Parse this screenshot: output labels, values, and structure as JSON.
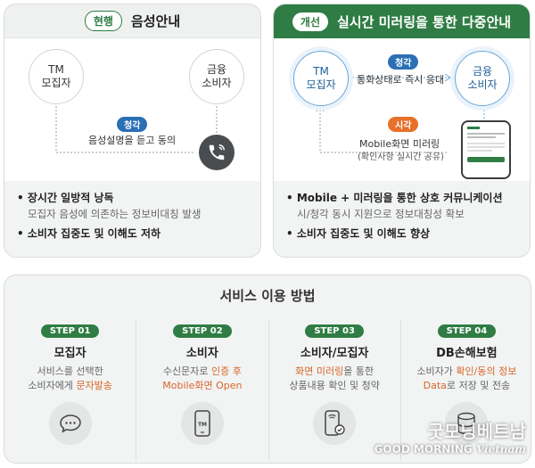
{
  "current": {
    "badge": "현행",
    "title": "음성안내",
    "node_tm": "TM\n모집자",
    "node_consumer": "금융\n소비자",
    "tag": "청각",
    "flow_text": "음성설명을 듣고 동의",
    "bullets": [
      {
        "main": "장시간 일방적 낭독",
        "sub": "모집자 음성에 의존하는 정보비대칭 발생"
      },
      {
        "main": "소비자 집중도 및 이해도 저하",
        "sub": ""
      }
    ]
  },
  "improved": {
    "badge": "개선",
    "title": "실시간 미러링을 통한 다중안내",
    "node_tm": "TM\n모집자",
    "node_consumer": "금융\n소비자",
    "tag_audio": "청각",
    "audio_text": "통화상태로 즉시 응대",
    "tag_visual": "시각",
    "visual_text": "Mobile화면 미러링",
    "visual_sub": "(확인사항 실시간 공유)",
    "bullets": [
      {
        "main": "Mobile + 미러링을 통한 상호 커뮤니케이션",
        "sub": "시/청각 동시 지원으로 정보대칭성 확보"
      },
      {
        "main": "소비자 집중도 및 이해도 향상",
        "sub": ""
      }
    ]
  },
  "service": {
    "title": "서비스 이용 방법",
    "steps": [
      {
        "badge": "STEP 01",
        "title": "모집자",
        "desc1": "서비스를 선택한",
        "desc2_plain": "소비자에게 ",
        "desc2_hl": "문자발송",
        "icon": "chat-bubble-icon"
      },
      {
        "badge": "STEP 02",
        "title": "소비자",
        "desc1_plain": "수신문자로 ",
        "desc1_hl": "인증 후",
        "desc2_hl": "Mobile화면 Open",
        "icon": "phone-tm-icon"
      },
      {
        "badge": "STEP 03",
        "title": "소비자/모집자",
        "desc1_hl": "화면 미러링",
        "desc1_plain": "을 통한",
        "desc2": "상품내용 확인 및 청약",
        "icon": "phone-check-icon"
      },
      {
        "badge": "STEP 04",
        "title": "DB손해보험",
        "desc1_plain": "소비자가 ",
        "desc1_hl": "확인/동의 정보",
        "desc2_hl": "Data",
        "desc2_plain": "로 저장 및 전송",
        "icon": "database-icon"
      }
    ]
  },
  "watermark": {
    "line1": "굿모닝베트남",
    "line2a": "GOOD MORNING",
    "line2b": "Vietnam"
  }
}
